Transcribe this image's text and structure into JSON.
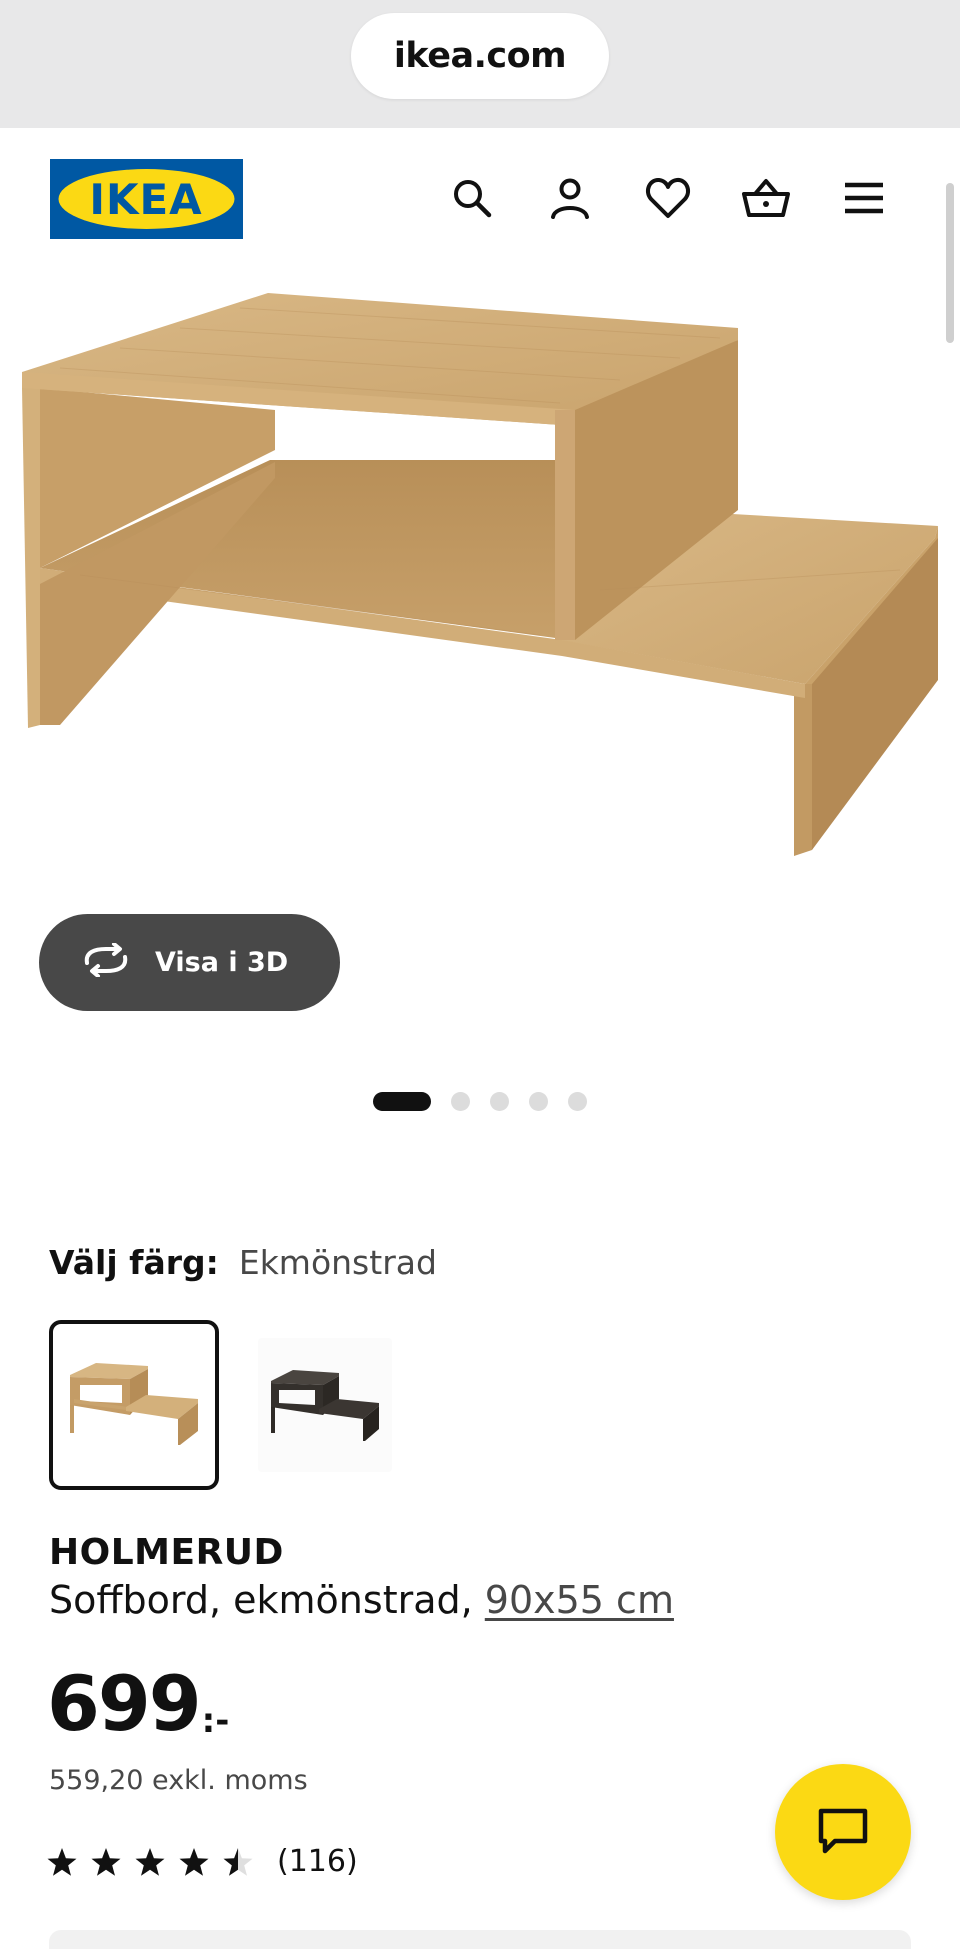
{
  "browser": {
    "url": "ikea.com"
  },
  "header": {
    "logo_text": "IKEA",
    "icons": [
      "search-icon",
      "account-icon",
      "heart-icon",
      "basket-icon",
      "menu-icon"
    ]
  },
  "gallery": {
    "view_3d_label": "Visa i 3D",
    "image_count": 5,
    "active_index": 0
  },
  "color": {
    "label": "Välj färg:",
    "selected": "Ekmönstrad",
    "options": [
      "oak-effect",
      "black-brown"
    ]
  },
  "product": {
    "name": "HOLMERUD",
    "description_prefix": "Soffbord, ekmönstrad, ",
    "size_link": "90x55 cm",
    "price": "699",
    "price_suffix": ":-",
    "price_ex_vat": "559,20 exkl. moms",
    "rating_value": 4.5,
    "rating_max": 5,
    "review_count": "(116)"
  },
  "colors": {
    "brand_blue": "#0058a3",
    "brand_yellow": "#fbd914",
    "button_dark": "#484848"
  }
}
